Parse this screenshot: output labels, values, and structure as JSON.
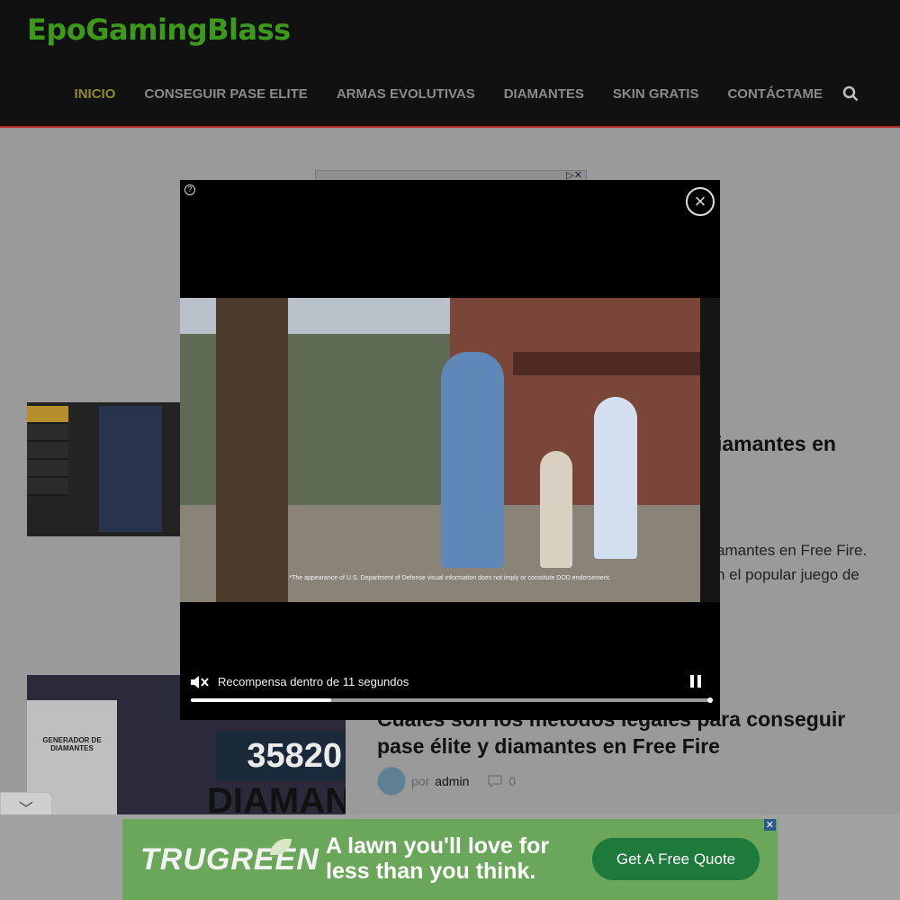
{
  "site": {
    "logo_text": "EpoGamingBlass"
  },
  "nav": {
    "items": [
      {
        "label": "INICIO",
        "active": true
      },
      {
        "label": "CONSEGUIR PASE ELITE"
      },
      {
        "label": "ARMAS EVOLUTIVAS"
      },
      {
        "label": "DIAMANTES"
      },
      {
        "label": "SKIN GRATIS"
      },
      {
        "label": "CONTÁCTAME"
      }
    ],
    "search_icon": "search-icon"
  },
  "articles": [
    {
      "title_visible": "iamantes en",
      "excerpt_line1": "amantes en Free Fire.",
      "excerpt_line2": "n el popular juego de"
    },
    {
      "title": "Cuáles son los métodos legales para conseguir pase élite y diamantes en Free Fire",
      "author_prefix": "por",
      "author": "admin",
      "comments": "0",
      "thumbnail_text_counter": "35820",
      "thumbnail_text_big": "DIAMANT",
      "thumbnail_text_title": "GENERADOR DE DIAMANTES"
    }
  ],
  "video_ad": {
    "countdown_label": "Recompensa dentro de 11 segundos",
    "progress": 0.27,
    "disclaimer": "*The appearance of U.S. Department of Defense visual information does not imply or constitute DOD endorsement."
  },
  "bottom_ad": {
    "brand": "TRUGREEN",
    "tagline_line1": "A lawn you'll love for",
    "tagline_line2": "less than you think.",
    "cta": "Get A Free Quote",
    "close": "✕"
  },
  "collapse_control": {
    "icon": "chevron-down-icon",
    "glyph": "﹀"
  },
  "colors": {
    "accent_green": "#3c9a1a",
    "nav_active": "#8f8a2b",
    "header_border": "#b02a2a",
    "ad_green": "#6aa75a",
    "cta_green": "#1e7a3a"
  }
}
